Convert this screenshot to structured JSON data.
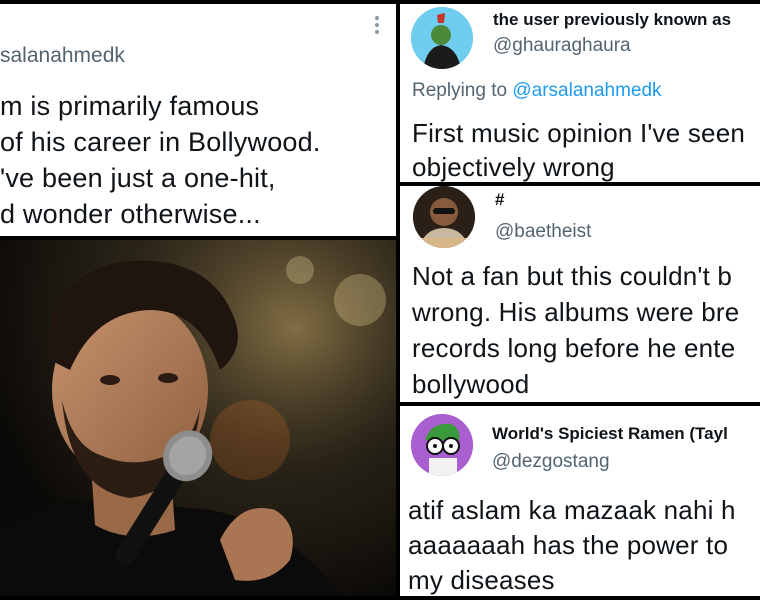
{
  "main_tweet": {
    "handle": "salanahmedk",
    "lines": [
      "m is primarily famous",
      "of his career in Bollywood.",
      "'ve been just a one-hit,",
      "d wonder otherwise..."
    ]
  },
  "replies": [
    {
      "name": "the user previously known as",
      "handle": "@ghauraghaura",
      "replying_prefix": "Replying to ",
      "replying_handle": "@arsalanahmedk",
      "lines": [
        "First music opinion I've seen",
        "objectively wrong"
      ]
    },
    {
      "name": "#",
      "handle": "@baetheist",
      "lines": [
        "Not a fan but this couldn't b",
        "wrong. His albums were bre",
        "records long before he ente",
        "bollywood"
      ]
    },
    {
      "name": "World's Spiciest Ramen (Tayl",
      "handle": "@dezgostang",
      "lines": [
        "atif aslam ka mazaak nahi h",
        "aaaaaaah has the power to",
        "my diseases"
      ]
    }
  ],
  "icons": {
    "more": "more-options-icon",
    "photo": "singer-photo"
  }
}
